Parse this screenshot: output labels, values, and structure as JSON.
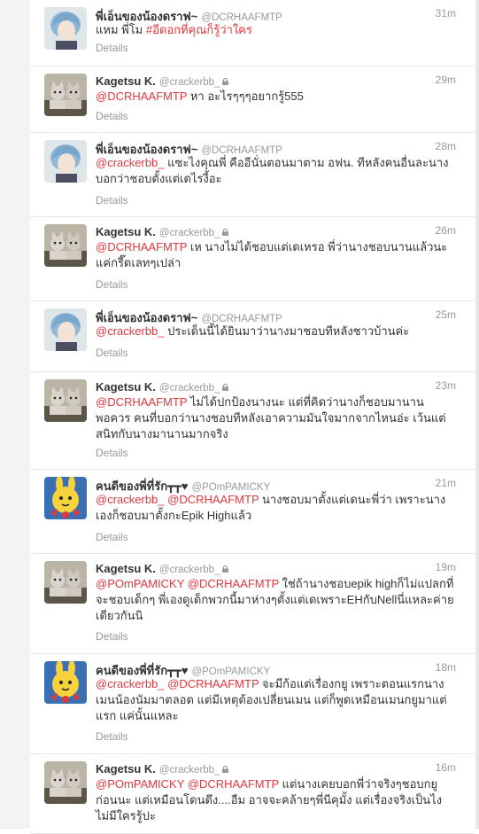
{
  "tweets": [
    {
      "name": "พี่เอ็นของน้องดราฟ~",
      "handle": "@DCRHAAFMTP",
      "protected": false,
      "time": "31m",
      "avatar": "blue-hair-avatar",
      "segments": [
        {
          "type": "text",
          "text": "แหม พี่โม "
        },
        {
          "type": "hashtag",
          "text": "#อีดอกที่คุณก็รู้ว่าใคร"
        }
      ],
      "details": "Details"
    },
    {
      "name": "Kagetsu K.",
      "handle": "@crackerbb_",
      "protected": true,
      "time": "29m",
      "avatar": "cats-avatar",
      "segments": [
        {
          "type": "mention",
          "text": "@DCRHAAFMTP"
        },
        {
          "type": "text",
          "text": " หา อะไรๆๆๆอยากรู้555"
        }
      ],
      "details": "Details"
    },
    {
      "name": "พี่เอ็นของน้องดราฟ~",
      "handle": "@DCRHAAFMTP",
      "protected": false,
      "time": "28m",
      "avatar": "blue-hair-avatar",
      "segments": [
        {
          "type": "mention",
          "text": "@crackerbb_"
        },
        {
          "type": "text",
          "text": " แซะไงคุณพี่ คืออีนั่นตอนมาตาม อฟน. ทีหลังคนอื่นละนางบอกว่าชอบตั้งแต่เดไรงี้อะ"
        }
      ],
      "details": "Details"
    },
    {
      "name": "Kagetsu K.",
      "handle": "@crackerbb_",
      "protected": true,
      "time": "26m",
      "avatar": "cats-avatar",
      "segments": [
        {
          "type": "mention",
          "text": "@DCRHAAFMTP"
        },
        {
          "type": "text",
          "text": " เห นางไม่ได้ชอบแต่เดเหรอ พี่ว่านางชอบนานแล้วนะ แค่กรี๊ดเลทๆเปล่า"
        }
      ],
      "details": "Details"
    },
    {
      "name": "พี่เอ็นของน้องดราฟ~",
      "handle": "@DCRHAAFMTP",
      "protected": false,
      "time": "25m",
      "avatar": "blue-hair-avatar",
      "segments": [
        {
          "type": "mention",
          "text": "@crackerbb_"
        },
        {
          "type": "text",
          "text": " ประเด็นนี้ได้ยินมาว่านางมาชอบทีหลังชาวบ้านค่ะ"
        }
      ],
      "details": "Details"
    },
    {
      "name": "Kagetsu K.",
      "handle": "@crackerbb_",
      "protected": true,
      "time": "23m",
      "avatar": "cats-avatar",
      "segments": [
        {
          "type": "mention",
          "text": "@DCRHAAFMTP"
        },
        {
          "type": "text",
          "text": " ไม่ได้ปกป้องนางนะ แต่ที่คิดว่านางก็ชอบมานานพอควร คนที่บอกว่านางชอบทีหลังเอาความมันใจมากจากไหนอ่ะ เว้นแต่สนิทกับนางมานานมากจริง"
        }
      ],
      "details": "Details"
    },
    {
      "name": "คนดีของพี่ที่รัก┳┳♥",
      "handle": "@POmPAMICKY",
      "protected": false,
      "time": "21m",
      "avatar": "cartoon-avatar",
      "segments": [
        {
          "type": "mention",
          "text": "@crackerbb_"
        },
        {
          "type": "text",
          "text": " "
        },
        {
          "type": "mention",
          "text": "@DCRHAAFMTP"
        },
        {
          "type": "text",
          "text": " นางชอบมาตั้งแต่เดนะพี่ว่า เพราะนางเองก็ชอบมาตั้งกะEpik Highแล้ว"
        }
      ],
      "details": "Details"
    },
    {
      "name": "Kagetsu K.",
      "handle": "@crackerbb_",
      "protected": true,
      "time": "19m",
      "avatar": "cats-avatar",
      "segments": [
        {
          "type": "mention",
          "text": "@POmPAMICKY"
        },
        {
          "type": "text",
          "text": " "
        },
        {
          "type": "mention",
          "text": "@DCRHAAFMTP"
        },
        {
          "type": "text",
          "text": " ใช่ถ้านางชอบepik highก็ไม่แปลกที่จะชอบเด็กๆ พี่เองดูเด็กพวกนี้มาห่างๆตั้งแต่เดเพราะEHกับNellนี่แหละค่ายเดียวกันนิ"
        }
      ],
      "details": "Details"
    },
    {
      "name": "คนดีของพี่ที่รัก┳┳♥",
      "handle": "@POmPAMICKY",
      "protected": false,
      "time": "18m",
      "avatar": "cartoon-avatar",
      "segments": [
        {
          "type": "mention",
          "text": "@crackerbb_"
        },
        {
          "type": "text",
          "text": " "
        },
        {
          "type": "mention",
          "text": "@DCRHAAFMTP"
        },
        {
          "type": "text",
          "text": " จะมีก้อแต่เรื่องกยู เพราะตอนแรกนางเมนน้องนัมมาตลอด แต่มีเหตุต้องเปลี่ยนเมน แต่ก็พูดเหมือนเมนกยูมาแต่แรก แค่นั้นแหละ"
        }
      ],
      "details": "Details"
    },
    {
      "name": "Kagetsu K.",
      "handle": "@crackerbb_",
      "protected": true,
      "time": "16m",
      "avatar": "cats-avatar",
      "segments": [
        {
          "type": "mention",
          "text": "@POmPAMICKY"
        },
        {
          "type": "text",
          "text": " "
        },
        {
          "type": "mention",
          "text": "@DCRHAAFMTP"
        },
        {
          "type": "text",
          "text": " แต่นางเคยบอกพี่ว่าจริงๆชอบกยูก่อนนะ แต่เหมือนโดนดึง....อืม อาจจะคล้ายๆพี่นีคุมั้ง แต่เรื่องจริงเป็นไงไม่มีใครรู้ปะ"
        }
      ],
      "details": ""
    }
  ],
  "colors": {
    "link": "#e0383e",
    "name": "#333333",
    "meta": "#999999"
  }
}
